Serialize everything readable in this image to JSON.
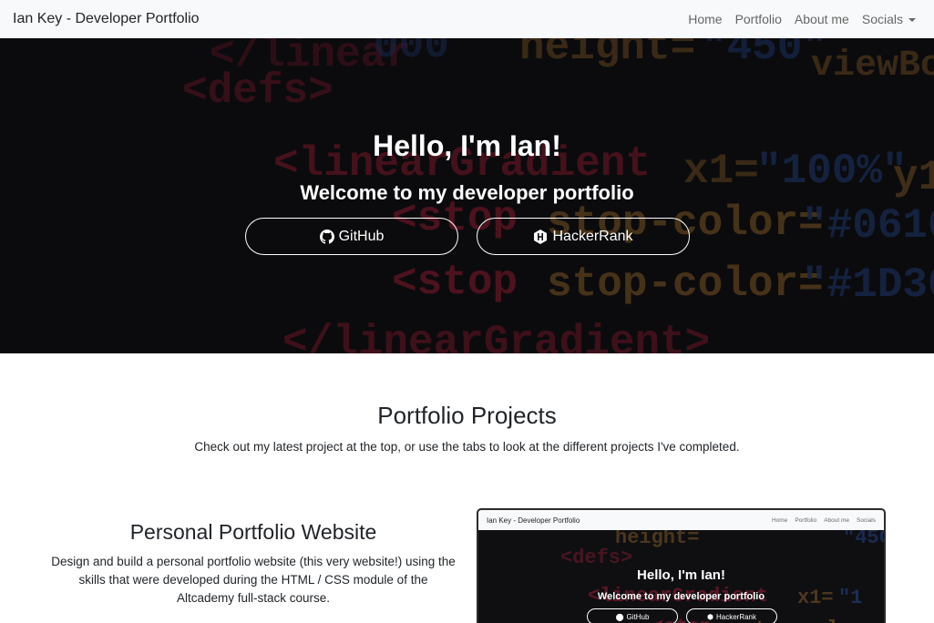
{
  "navbar": {
    "brand": "Ian Key - Developer Portfolio",
    "links": [
      "Home",
      "Portfolio",
      "About me"
    ],
    "dropdown_label": "Socials"
  },
  "hero": {
    "title": "Hello, I'm Ian!",
    "subtitle": "Welcome to my developer portfolio",
    "buttons": [
      {
        "label": "GitHub",
        "icon": "github-icon"
      },
      {
        "label": "HackerRank",
        "icon": "hackerrank-icon"
      }
    ]
  },
  "portfolio": {
    "title": "Portfolio Projects",
    "subtitle": "Check out my latest project at the top, or use the tabs to look at the different projects I've completed."
  },
  "project": {
    "title": "Personal Portfolio Website",
    "description": "Design and build a personal portfolio website (this very website!) using the skills that were developed during the HTML / CSS module of the Altcademy full-stack course."
  },
  "preview": {
    "brand": "Ian Key - Developer Portfolio",
    "links": [
      "Home",
      "Portfolio",
      "About me",
      "Socials"
    ],
    "title": "Hello, I'm Ian!",
    "subtitle": "Welcome to my developer portfolio",
    "buttons": [
      "GitHub",
      "HackerRank"
    ]
  },
  "colors": {
    "navbar_bg": "#f8f9fa",
    "hero_bg": "#0f0f12",
    "code_red": "#c0243e",
    "code_orange": "#b07a34",
    "code_blue": "#2b4f9b",
    "text": "#212529"
  }
}
